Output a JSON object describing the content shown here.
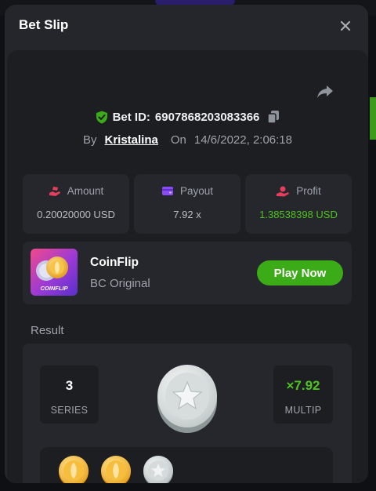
{
  "modal": {
    "title": "Bet Slip",
    "close_icon": "close-icon"
  },
  "bet": {
    "id_label": "Bet ID:",
    "id_value": "6907868203083366",
    "by_label": "By",
    "username": "Kristalina",
    "on_label": "On",
    "datetime": "14/6/2022, 2:06:18"
  },
  "stats": [
    {
      "label": "Amount",
      "value": "0.20020000 USD",
      "icon": "bet-hand-icon",
      "icon_color": "#e63e5c"
    },
    {
      "label": "Payout",
      "value": "7.92 x",
      "icon": "wallet-icon",
      "icon_color": "#8a4cf6"
    },
    {
      "label": "Profit",
      "value": "1.38538398 USD",
      "icon": "profit-hand-icon",
      "icon_color": "#e63e5c",
      "value_color": "#4fc31e"
    }
  ],
  "game": {
    "name": "CoinFlip",
    "subtitle": "BC Original",
    "thumb_text": "COINFLIP",
    "play_label": "Play Now"
  },
  "result": {
    "label": "Result",
    "series_value": "3",
    "series_label": "SERIES",
    "multiplier_value": "×7.92",
    "multiplier_label": "MULTIP",
    "big_coin": "silver-star-coin",
    "history": [
      "gold-coin",
      "gold-coin",
      "silver-coin"
    ]
  },
  "colors": {
    "accent_green": "#3bab18",
    "text_green": "#4fc31e",
    "modal_bg": "#24262b",
    "panel_bg": "#1c1e22",
    "card_bg": "#25272c"
  }
}
